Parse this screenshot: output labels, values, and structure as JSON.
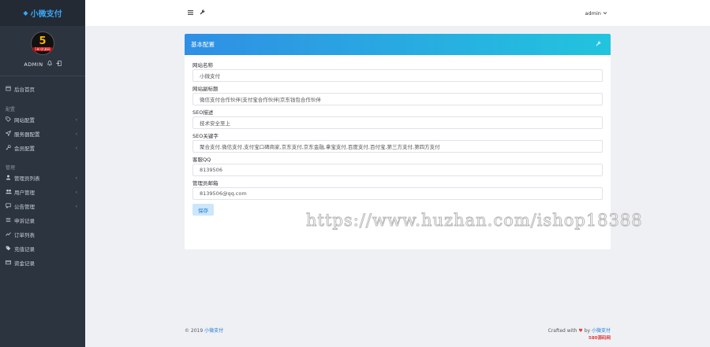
{
  "brand": {
    "icon": "◆",
    "name": "小微支付"
  },
  "user": {
    "avatar_number": "5",
    "avatar_tag": "580资源网",
    "name": "ADMIN"
  },
  "sidebar": {
    "dashboard": "后台首页",
    "section_config": "配置",
    "config_items": [
      {
        "label": "网站配置",
        "icon": "tag-icon"
      },
      {
        "label": "服务器配置",
        "icon": "send-icon"
      },
      {
        "label": "会员配置",
        "icon": "key-icon"
      }
    ],
    "section_manage": "管理",
    "manage_items": [
      {
        "label": "管理员列表",
        "chev": true
      },
      {
        "label": "用户管理",
        "chev": true
      },
      {
        "label": "公告管理",
        "chev": true
      },
      {
        "label": "申诉记录",
        "chev": false
      },
      {
        "label": "订单列表",
        "chev": false
      },
      {
        "label": "充值记录",
        "chev": false
      },
      {
        "label": "资金记录",
        "chev": false
      }
    ]
  },
  "topbar": {
    "admin_label": "admin"
  },
  "card": {
    "title": "基本配置",
    "fields": [
      {
        "label": "网站名称",
        "value": "小微支付"
      },
      {
        "label": "网站副标题",
        "value": "微信支付合作伙伴|支付宝合作伙伴|京东钱包合作伙伴"
      },
      {
        "label": "SEO描述",
        "value": "技术安全至上"
      },
      {
        "label": "SEO关键字",
        "value": "聚合支付,微信支付,支付宝口碑商家,京东支付,京东金融,拿宝支付,百度支付,百付宝,第三方支付,第四方支付"
      },
      {
        "label": "客服QQ",
        "value": "8139506"
      },
      {
        "label": "管理员邮箱",
        "value": "8139506@qq.com"
      }
    ],
    "save_label": "保存"
  },
  "footer": {
    "copyright": "© 2019",
    "copyright_link": "小微支付",
    "crafted_prefix": "Crafted with",
    "crafted_by": "by",
    "crafted_link": "小微支付",
    "sub": "580源码网"
  },
  "watermark": "https://www.huzhan.com/ishop18388"
}
